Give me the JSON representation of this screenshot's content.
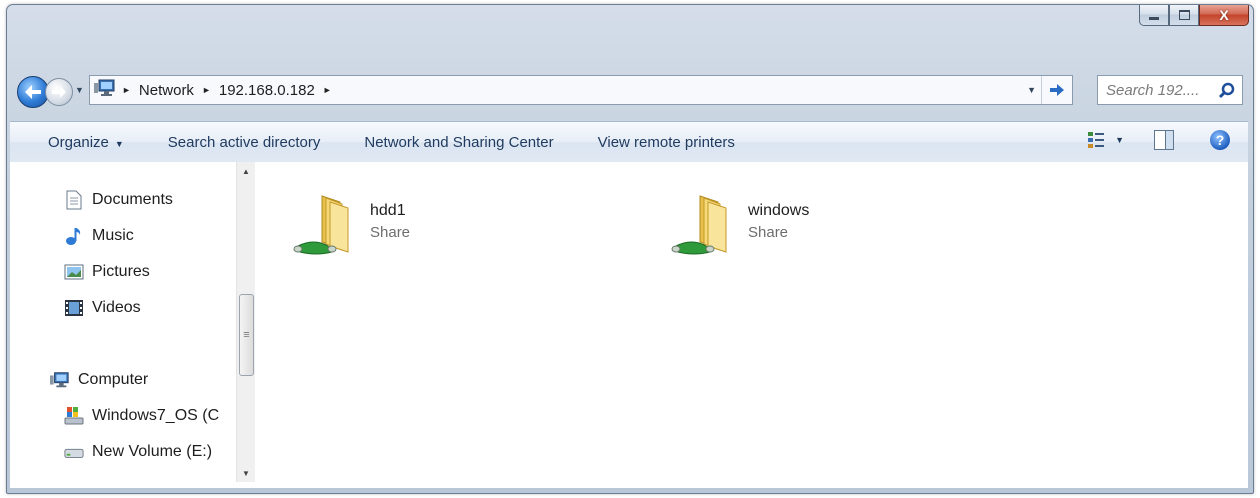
{
  "window": {
    "caption_buttons": {
      "minimize": "minimize",
      "maximize": "maximize",
      "close": "X"
    }
  },
  "address_bar": {
    "breadcrumbs": [
      "Network",
      "192.168.0.182"
    ],
    "search_placeholder": "Search 192...."
  },
  "toolbar": {
    "organize": "Organize",
    "search_active_directory": "Search active directory",
    "network_sharing_center": "Network and Sharing Center",
    "view_remote_printers": "View remote printers"
  },
  "nav_pane": {
    "items": [
      {
        "label": "Documents",
        "icon": "documents-icon"
      },
      {
        "label": "Music",
        "icon": "music-icon"
      },
      {
        "label": "Pictures",
        "icon": "pictures-icon"
      },
      {
        "label": "Videos",
        "icon": "videos-icon"
      },
      {
        "label": "Computer",
        "icon": "computer-icon"
      },
      {
        "label": "Windows7_OS (C",
        "icon": "windows-drive-icon"
      },
      {
        "label": "New Volume (E:)",
        "icon": "drive-icon"
      }
    ]
  },
  "shares": [
    {
      "name": "hdd1",
      "type": "Share",
      "icon": "shared-folder-icon"
    },
    {
      "name": "windows",
      "type": "Share",
      "icon": "shared-folder-icon"
    }
  ],
  "colors": {
    "toolbar_text": "#1e3a5f",
    "close_button": "#c4432a",
    "accent_blue": "#2e7bd6"
  }
}
